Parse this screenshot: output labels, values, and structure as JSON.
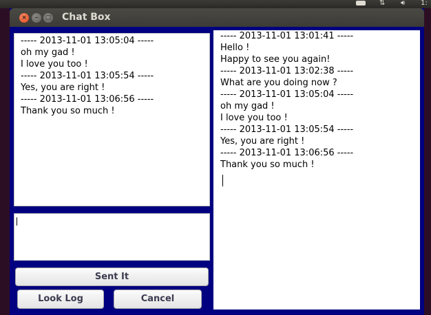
{
  "window": {
    "title": "Chat Box"
  },
  "system_panel": {
    "clock": "1:"
  },
  "received": {
    "lines": [
      "----- 2013-11-01 13:05:04 -----",
      "oh my gad !",
      "I love you too !",
      "----- 2013-11-01 13:05:54 -----",
      "Yes, you are right !",
      "----- 2013-11-01 13:06:56 -----",
      "Thank you so much !"
    ]
  },
  "message_input": {
    "value": ""
  },
  "chat_log": {
    "lines": [
      "----- 2013-11-01 13:01:41 -----",
      "Hello !",
      "Happy to see you again!",
      "----- 2013-11-01 13:02:38 -----",
      "What are you doing now ?",
      "----- 2013-11-01 13:05:04 -----",
      "oh my gad !",
      "I love you too !",
      "----- 2013-11-01 13:05:54 -----",
      "Yes, you are right !",
      "----- 2013-11-01 13:06:56 -----",
      "Thank you so much !"
    ]
  },
  "buttons": {
    "sent": "Sent It",
    "look_log": "Look Log",
    "cancel": "Cancel"
  },
  "colors": {
    "window_bg": "#000080",
    "title_bar": "#3c3b37",
    "close_button": "#e0461d"
  }
}
